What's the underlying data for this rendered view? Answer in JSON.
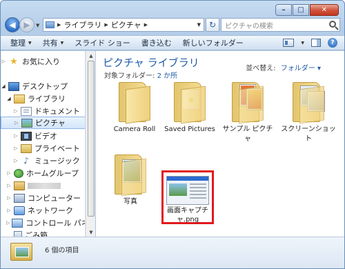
{
  "window": {
    "caption_buttons": [
      "minimize",
      "maximize",
      "close"
    ]
  },
  "address": {
    "crumbs": [
      "ライブラリ",
      "ピクチャ"
    ],
    "search_placeholder": "ピクチャの検索"
  },
  "toolbar": {
    "organize": "整理",
    "share": "共有",
    "slideshow": "スライド ショー",
    "burn": "書き込む",
    "new_folder": "新しいフォルダー"
  },
  "nav": {
    "favorites": "お気に入り",
    "desktop": "デスクトップ",
    "libraries": "ライブラリ",
    "documents": "ドキュメント",
    "pictures": "ピクチャ",
    "videos": "ビデオ",
    "private": "プライベート",
    "music": "ミュージック",
    "homegroup": "ホームグループ",
    "computer": "コンピューター",
    "network": "ネットワーク",
    "control_panel": "コントロール パネル",
    "recycle_bin": "ごみ箱"
  },
  "content": {
    "title": "ピクチャ ライブラリ",
    "subtitle_prefix": "対象フォルダー: ",
    "subtitle_link": "2 か所",
    "arrange_label": "並べ替え:",
    "arrange_value": "フォルダー ▾",
    "items": [
      {
        "label": "Camera Roll",
        "type": "folder"
      },
      {
        "label": "Saved Pictures",
        "type": "folder"
      },
      {
        "label": "サンプル ピクチャ",
        "type": "folder"
      },
      {
        "label": "スクリーンショット",
        "type": "folder"
      },
      {
        "label": "写真",
        "type": "folder"
      },
      {
        "label": "画面キャプチャ.png",
        "type": "file",
        "selected": true
      }
    ]
  },
  "details": {
    "item_count": "6 個の項目"
  },
  "colors": {
    "highlight_border": "#e2181e",
    "title_blue": "#1f5aa8"
  }
}
